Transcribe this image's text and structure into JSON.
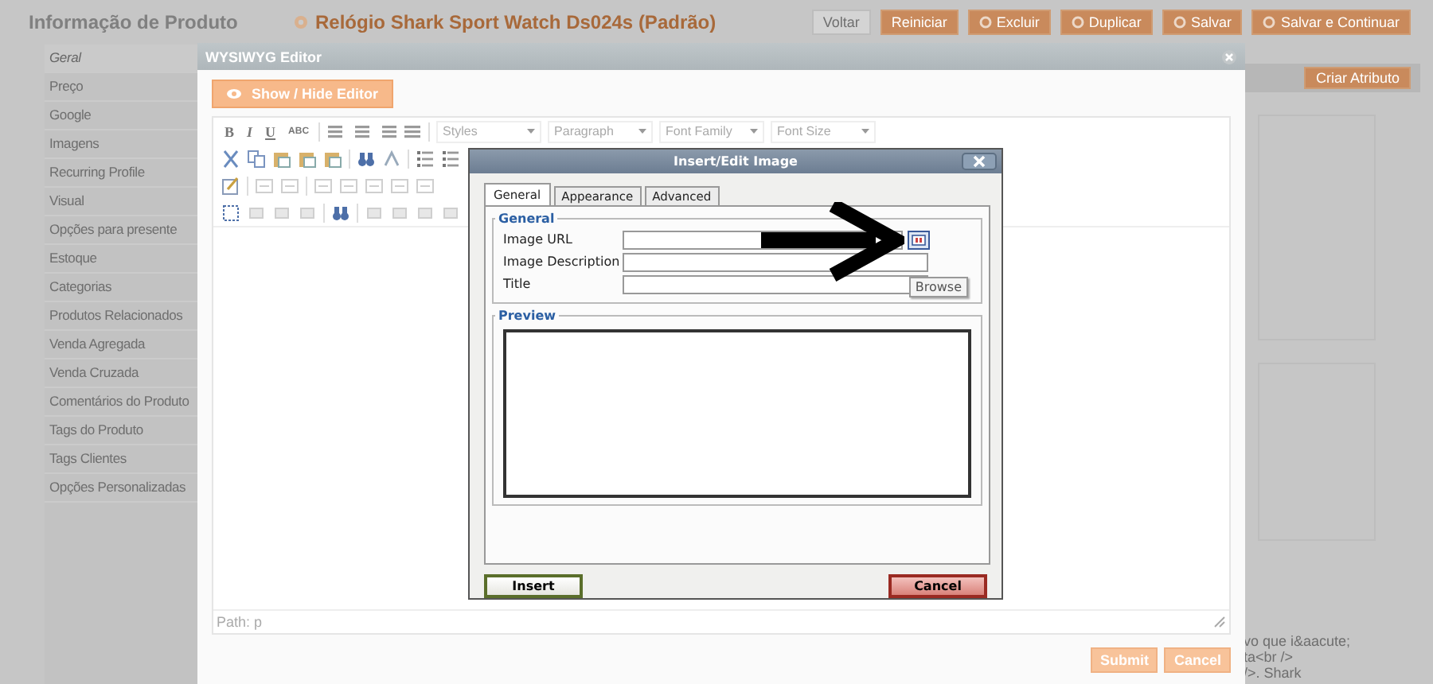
{
  "page": {
    "title": "Informação de Produto",
    "product_title": "Relógio Shark Sport Watch Ds024s (Padrão)",
    "buttons": [
      {
        "label": "Voltar",
        "kind": "back"
      },
      {
        "label": "Reiniciar",
        "kind": "plain"
      },
      {
        "label": "Excluir",
        "kind": "iconed"
      },
      {
        "label": "Duplicar",
        "kind": "iconed"
      },
      {
        "label": "Salvar",
        "kind": "iconed"
      },
      {
        "label": "Salvar e Continuar",
        "kind": "iconed"
      }
    ]
  },
  "sidebar": {
    "items": [
      {
        "label": "Geral",
        "selected": true
      },
      {
        "label": "Preço",
        "selected": false
      },
      {
        "label": "Google",
        "selected": false
      },
      {
        "label": "Imagens",
        "selected": false
      },
      {
        "label": "Recurring Profile",
        "selected": false
      },
      {
        "label": "Visual",
        "selected": false
      },
      {
        "label": "Opções para presente",
        "selected": false
      },
      {
        "label": "Estoque",
        "selected": false
      },
      {
        "label": "Categorias",
        "selected": false
      },
      {
        "label": "Produtos Relacionados",
        "selected": false
      },
      {
        "label": "Venda Agregada",
        "selected": false
      },
      {
        "label": "Venda Cruzada",
        "selected": false
      },
      {
        "label": "Comentários do Produto",
        "selected": false
      },
      {
        "label": "Tags do Produto",
        "selected": false
      },
      {
        "label": "Tags Clientes",
        "selected": false
      },
      {
        "label": "Opções Personalizadas",
        "selected": false
      }
    ]
  },
  "side_button": "Criar Atributo",
  "code_fragments": [
    "vo que i&aacute;",
    "ta<br />",
    "/>. Shark"
  ],
  "editor": {
    "title": "WYSIWYG Editor",
    "toggle_button": "Show / Hide Editor",
    "format_buttons": [
      "B",
      "I",
      "U",
      "ABC"
    ],
    "selects": [
      "Styles",
      "Paragraph",
      "Font Family",
      "Font Size"
    ],
    "path": "Path: p",
    "buttons": [
      "Submit",
      "Cancel"
    ]
  },
  "image_dialog": {
    "title": "Insert/Edit Image",
    "tabs": [
      {
        "label": "General",
        "selected": true
      },
      {
        "label": "Appearance",
        "selected": false
      },
      {
        "label": "Advanced",
        "selected": false
      }
    ],
    "general_legend": "General",
    "fields": [
      {
        "label": "Image URL",
        "browse": true
      },
      {
        "label": "Image Description",
        "browse": false
      },
      {
        "label": "Title",
        "browse": false
      }
    ],
    "tooltip": "Browse",
    "preview_legend": "Preview",
    "buttons": [
      {
        "label": "Insert",
        "kind": "insert"
      },
      {
        "label": "Cancel",
        "kind": "cancel"
      }
    ]
  }
}
